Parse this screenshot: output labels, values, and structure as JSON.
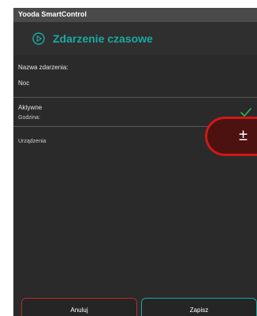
{
  "app": {
    "title": "Yooda SmartControl"
  },
  "header": {
    "title": "Zdarzenie czasowe",
    "icon": "play-circle-icon",
    "accent": "#1aa9a1"
  },
  "form": {
    "event_name_label": "Nazwa zdarzenia:",
    "event_name_value": "Noc",
    "active_label": "Aktywne",
    "active_icon": "check-icon",
    "time_label": "Godzina:",
    "devices_label": "Urządzenia"
  },
  "fab": {
    "symbol": "±",
    "color": "#d01818"
  },
  "footer": {
    "cancel_label": "Anuluj",
    "save_label": "Zapisz"
  }
}
